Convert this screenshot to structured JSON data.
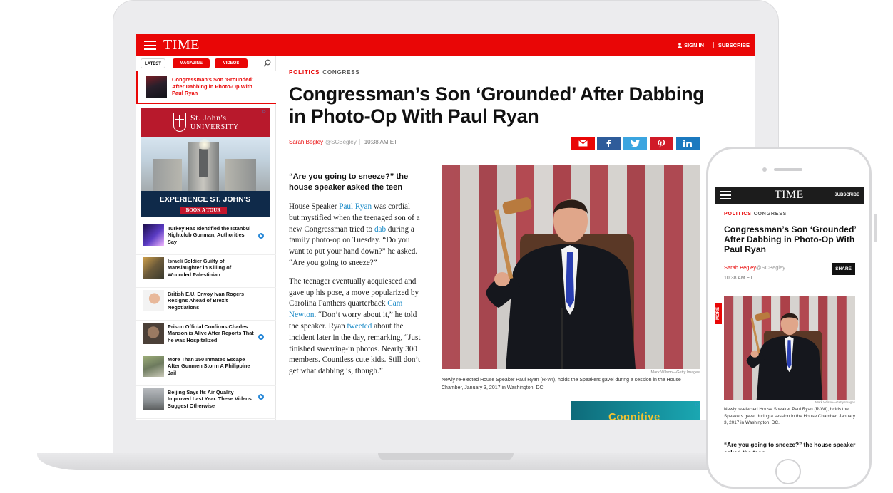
{
  "site": {
    "logo": "TIME",
    "sign_in": "SIGN IN",
    "subscribe": "SUBSCRIBE"
  },
  "sidebar": {
    "tabs": [
      "LATEST",
      "MAGAZINE",
      "VIDEOS"
    ],
    "current_story": "Congressman's Son 'Grounded' After Dabbing in Photo-Op With Paul Ryan",
    "ad": {
      "university_line1": "St. John's",
      "university_line2": "UNIVERSITY",
      "headline": "EXPERIENCE ST. JOHN'S",
      "button": "BOOK A TOUR"
    },
    "items": [
      {
        "text": "Turkey Has Identified the Istanbul Nightclub Gunman, Authorities Say",
        "video": true
      },
      {
        "text": "Israeli Soldier Guilty of Manslaughter in Killing of Wounded Palestinian",
        "video": false
      },
      {
        "text": "British E.U. Envoy Ivan Rogers Resigns Ahead of Brexit Negotiations",
        "video": false
      },
      {
        "text": "Prison Official Confirms Charles Manson is Alive After Reports That he was Hospitalized",
        "video": true
      },
      {
        "text": "More Than 150 Inmates Escape After Gunmen Storm A Philippine Jail",
        "video": false
      },
      {
        "text": "Beijing Says Its Air Quality Improved Last Year. These Videos Suggest Otherwise",
        "video": true
      }
    ]
  },
  "article": {
    "section": "POLITICS",
    "subsection": "CONGRESS",
    "headline": "Congressman’s Son ‘Grounded’ After Dabbing in Photo-Op With Paul Ryan",
    "author": "Sarah Begley",
    "handle": "@SCBegley",
    "time": "10:38 AM ET",
    "pullquote": "“Are you going to sneeze?” the house speaker asked the teen",
    "p1_a": "House Speaker ",
    "p1_link1": "Paul Ryan",
    "p1_b": " was cordial but mystified when the teenaged son of a new Congressman tried to ",
    "p1_link2": "dab",
    "p1_c": " during a family photo-op on Tuesday. “Do you want to put your hand down?” he asked. “Are you going to sneeze?”",
    "p2_a": "The teenager eventually acquiesced and gave up his pose, a move popularized by Carolina Panthers quarterback ",
    "p2_link1": "Cam Newton",
    "p2_b": ". “Don’t worry about it,” he told the speaker. Ryan ",
    "p2_link2": "tweeted",
    "p2_c": " about the incident later in the day, remarking, “Just finished swearing-in photos. Nearly 300 members. Countless cute kids. Still don’t get what dabbing is, though.”",
    "photo_credit": "Mark Wilson—Getty Images",
    "photo_caption": "Newly re-elected House Speaker Paul Ryan (R-WI), holds the Speakers gavel during a session in the House Chamber, January 3, 2017 in Washington, DC.",
    "ad_word": "Cognitive"
  },
  "mobile": {
    "logo": "TIME",
    "subscribe": "SUBSCRIBE",
    "section": "POLITICS",
    "subsection": "CONGRESS",
    "headline": "Congressman’s Son ‘Grounded’ After Dabbing in Photo-Op With Paul Ryan",
    "author": "Sarah Begley",
    "handle": "@SCBegley",
    "time": "10:38 AM ET",
    "share": "SHARE",
    "more": "MORE",
    "photo_credit": "Mark Wilson—Getty Images",
    "photo_caption": "Newly re-elected House Speaker Paul Ryan (R-WI), holds the Speakers gavel during a session in the House Chamber, January 3, 2017 in Washington, DC.",
    "pullquote": "“Are you going to sneeze?” the house speaker asked the teen"
  },
  "colors": {
    "brand_red": "#e90606",
    "link_blue": "#1a8ac7",
    "facebook": "#2f5c9a",
    "twitter": "#3ba5e0",
    "pinterest": "#d01a28",
    "linkedin": "#1b79bf"
  },
  "icons": [
    "menu-icon",
    "user-icon",
    "search-icon",
    "play-icon",
    "email-icon",
    "facebook-icon",
    "twitter-icon",
    "pinterest-icon",
    "linkedin-icon"
  ]
}
